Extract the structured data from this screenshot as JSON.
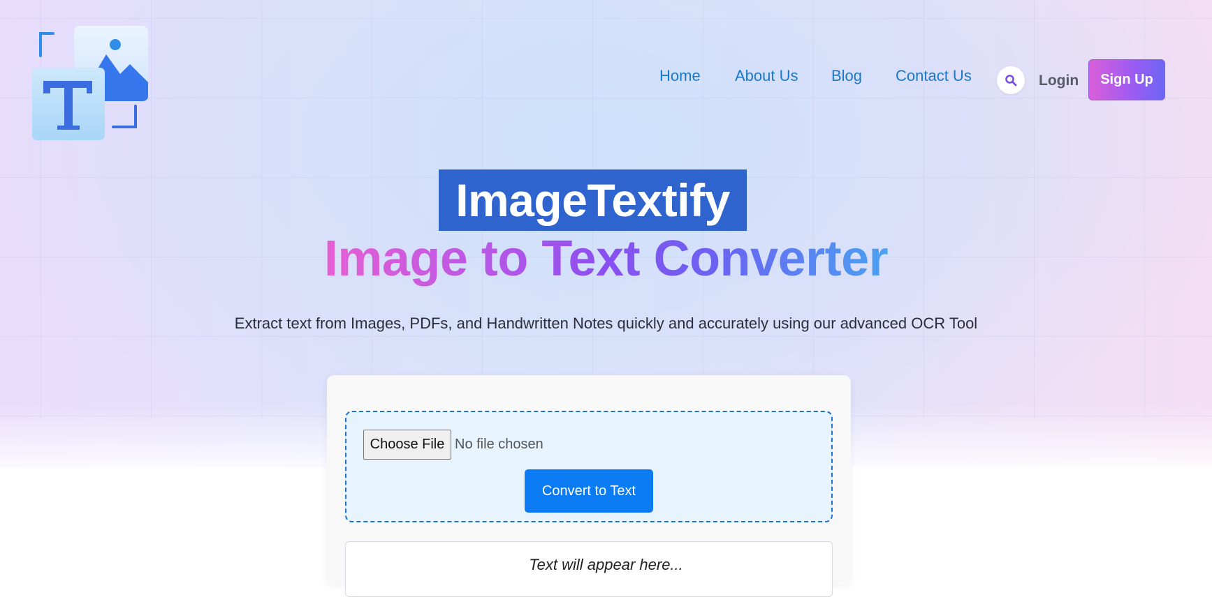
{
  "nav": {
    "items": [
      {
        "label": "Home"
      },
      {
        "label": "About Us"
      },
      {
        "label": "Blog"
      },
      {
        "label": "Contact Us"
      }
    ],
    "login_label": "Login",
    "signup_label": "Sign Up",
    "search_icon": "search-icon"
  },
  "hero": {
    "brand": "ImageTextify",
    "headline": "Image to Text Converter",
    "subtitle": "Extract text from Images, PDFs, and Handwritten Notes quickly and accurately using our advanced OCR Tool"
  },
  "converter": {
    "choose_file_label": "Choose File",
    "file_status": "No file chosen",
    "convert_label": "Convert to Text",
    "output_placeholder": "Text will appear here..."
  },
  "colors": {
    "nav_link": "#1a78c8",
    "brand_highlight": "#2f64cf",
    "convert_button": "#0a7bf2",
    "dropzone_border": "#1f72c9"
  }
}
